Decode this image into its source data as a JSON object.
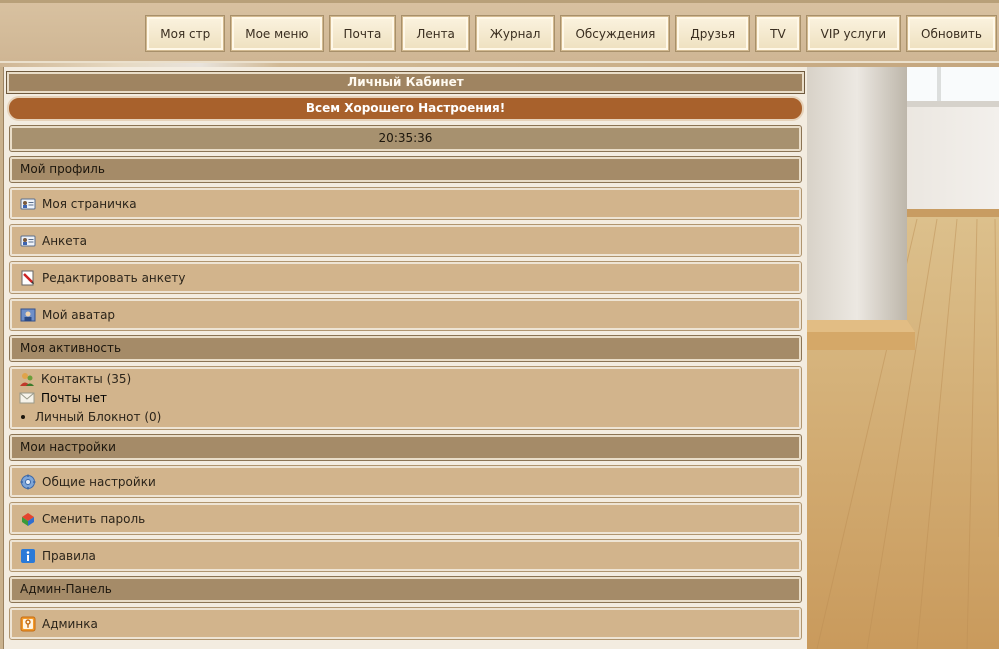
{
  "nav": [
    {
      "label": "Моя стр"
    },
    {
      "label": "Мое меню"
    },
    {
      "label": "Почта"
    },
    {
      "label": "Лента"
    },
    {
      "label": "Журнал"
    },
    {
      "label": "Обсуждения"
    },
    {
      "label": "Друзья"
    },
    {
      "label": "TV"
    },
    {
      "label": "VIP услуги"
    },
    {
      "label": "Обновить"
    }
  ],
  "panel": {
    "title": "Личный Кабинет",
    "greeting": "Всем Хорошего Настроения!",
    "clock": "20:35:36"
  },
  "profile": {
    "header": "Мой профиль",
    "items": [
      {
        "label": "Моя страничка",
        "icon": "id-card-icon"
      },
      {
        "label": "Анкета",
        "icon": "id-card-icon"
      },
      {
        "label": "Редактировать анкету",
        "icon": "edit-document-icon"
      },
      {
        "label": "Мой аватар",
        "icon": "avatar-icon"
      }
    ]
  },
  "activity": {
    "header": "Моя активность",
    "contacts": "Контакты (35)",
    "mail": "Почты нет",
    "notebook": "Личный Блокнот (0)"
  },
  "settings": {
    "header": "Мои настройки",
    "items": [
      {
        "label": "Общие настройки",
        "icon": "gear-icon"
      },
      {
        "label": "Сменить пароль",
        "icon": "password-icon"
      },
      {
        "label": "Правила",
        "icon": "info-icon"
      }
    ]
  },
  "admin": {
    "header": "Админ-Панель",
    "items": [
      {
        "label": "Админка",
        "icon": "key-icon"
      }
    ]
  }
}
